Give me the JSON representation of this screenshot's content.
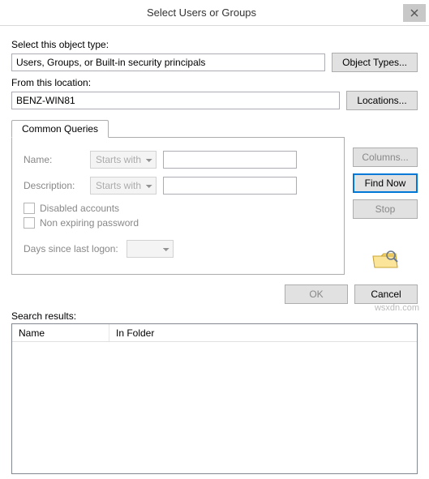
{
  "title": "Select Users or Groups",
  "object_type": {
    "label": "Select this object type:",
    "value": "Users, Groups, or Built-in security principals",
    "button": "Object Types..."
  },
  "location": {
    "label": "From this location:",
    "value": "BENZ-WIN81",
    "button": "Locations..."
  },
  "tab": {
    "label": "Common Queries",
    "name": {
      "label": "Name:",
      "mode": "Starts with",
      "value": ""
    },
    "description": {
      "label": "Description:",
      "mode": "Starts with",
      "value": ""
    },
    "disabled_accounts": "Disabled accounts",
    "non_expiring": "Non expiring password",
    "days_since": {
      "label": "Days since last logon:",
      "value": ""
    }
  },
  "side": {
    "columns": "Columns...",
    "find_now": "Find Now",
    "stop": "Stop"
  },
  "bottom": {
    "ok": "OK",
    "cancel": "Cancel"
  },
  "results": {
    "label": "Search results:",
    "col_name": "Name",
    "col_folder": "In Folder",
    "rows": []
  },
  "watermark": "wsxdn.com"
}
